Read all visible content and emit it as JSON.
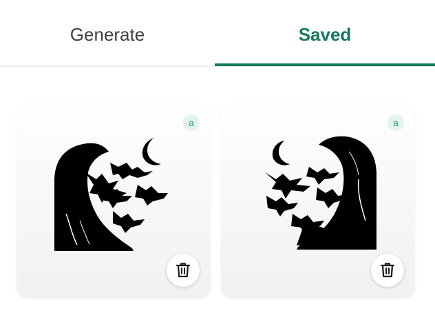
{
  "tabs": {
    "generate_label": "Generate",
    "saved_label": "Saved",
    "active": "saved"
  },
  "colors": {
    "accent": "#177a5c",
    "badge_bg": "#e3f4ec",
    "badge_fg": "#2c9a70"
  },
  "saved_items": [
    {
      "badge_icon": "ai-generated-icon",
      "badge_text": "a",
      "action_icon": "trash-icon"
    },
    {
      "badge_icon": "ai-generated-icon",
      "badge_text": "a",
      "action_icon": "trash-icon"
    }
  ]
}
